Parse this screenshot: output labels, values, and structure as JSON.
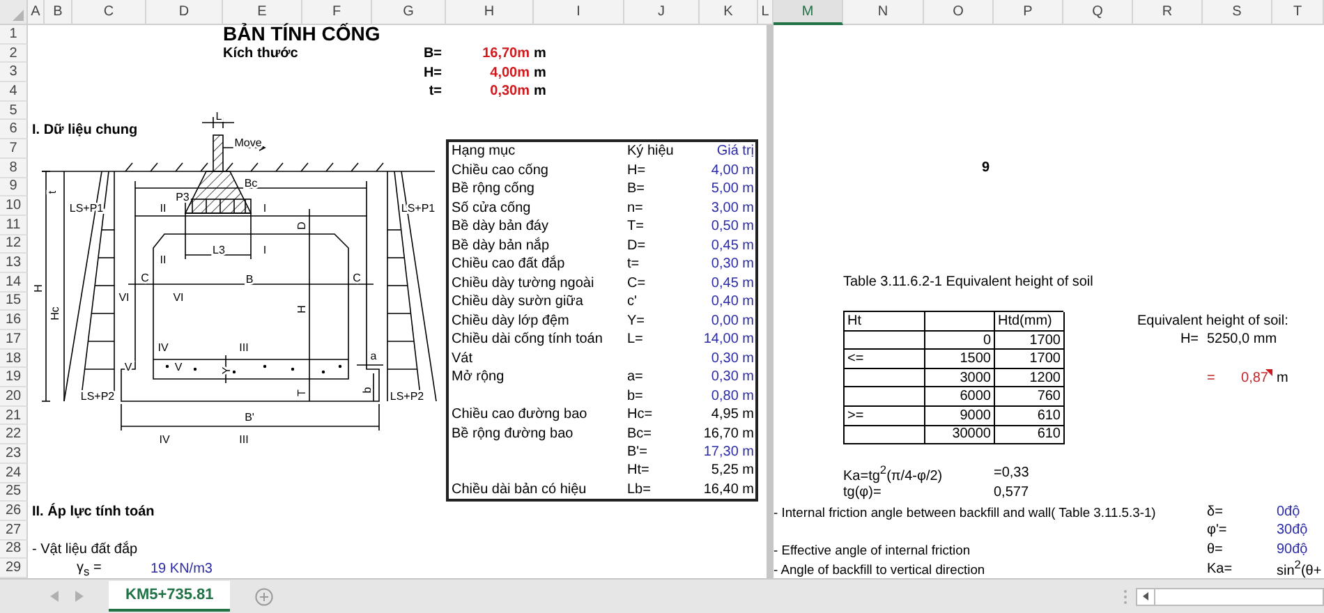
{
  "sheet": {
    "columns": [
      {
        "label": "A",
        "selected": false
      },
      {
        "label": "B",
        "selected": false
      },
      {
        "label": "C",
        "selected": false
      },
      {
        "label": "D",
        "selected": false
      },
      {
        "label": "E",
        "selected": false
      },
      {
        "label": "F",
        "selected": false
      },
      {
        "label": "G",
        "selected": false
      },
      {
        "label": "H",
        "selected": false
      },
      {
        "label": "I",
        "selected": false
      },
      {
        "label": "J",
        "selected": false
      },
      {
        "label": "K",
        "selected": false
      },
      {
        "label": "L",
        "selected": false
      },
      {
        "label": "M",
        "selected": true
      },
      {
        "label": "N",
        "selected": false
      },
      {
        "label": "O",
        "selected": false
      },
      {
        "label": "P",
        "selected": false
      },
      {
        "label": "Q",
        "selected": false
      },
      {
        "label": "R",
        "selected": false
      },
      {
        "label": "S",
        "selected": false
      },
      {
        "label": "T",
        "selected": false
      }
    ],
    "row_numbers": [
      "1",
      "2",
      "3",
      "4",
      "5",
      "6",
      "7",
      "8",
      "9",
      "10",
      "11",
      "12",
      "13",
      "14",
      "15",
      "16",
      "17",
      "18",
      "19",
      "20",
      "21",
      "22",
      "23",
      "24",
      "25",
      "26",
      "27",
      "28",
      "29"
    ]
  },
  "title": "BẢN TÍNH CỐNG",
  "dimensions": {
    "label": "Kích thước",
    "items": [
      {
        "symbol": "B=",
        "value": "16,70m",
        "unit": "m"
      },
      {
        "symbol": "H=",
        "value": "4,00m",
        "unit": "m"
      },
      {
        "symbol": "t=",
        "value": "0,30m",
        "unit": "m"
      }
    ]
  },
  "section_1": "I.  Dữ liệu chung",
  "diagram": {
    "labels": [
      "L",
      "Move",
      "Bc",
      "t",
      "P3",
      "LS+P1",
      "II",
      "I",
      "LS+P1",
      "D",
      "L3",
      "I",
      "II",
      "C",
      "B",
      "C",
      "H",
      "VI",
      "VI",
      "H",
      "Hc",
      "IV",
      "III",
      "a",
      "V",
      "V",
      "Y",
      "LS+P2",
      "T",
      "b",
      "LS+P2",
      "B'",
      "IV",
      "III"
    ]
  },
  "parameters": {
    "columns": [
      "Hạng mục",
      "Ký hiệu",
      "Giá trị"
    ],
    "rows": [
      {
        "item": "Chiều cao cống",
        "symbol": "H=",
        "value": "4,00 m",
        "color": "#2b2ba8"
      },
      {
        "item": "Bề rộng cống",
        "symbol": "B=",
        "value": "5,00 m",
        "color": "#2b2ba8"
      },
      {
        "item": "Số cửa cống",
        "symbol": "n=",
        "value": "3,00 m",
        "color": "#2b2ba8"
      },
      {
        "item": "Bề dày bản đáy",
        "symbol": "T=",
        "value": "0,50 m",
        "color": "#2b2ba8"
      },
      {
        "item": "Bề dày bản nắp",
        "symbol": "D=",
        "value": "0,45 m",
        "color": "#2b2ba8"
      },
      {
        "item": "Chiều cao đất đắp",
        "symbol": "t=",
        "value": "0,30 m",
        "color": "#2b2ba8"
      },
      {
        "item": "Chiều dày tường ngoài",
        "symbol": "C=",
        "value": "0,45 m",
        "color": "#2b2ba8"
      },
      {
        "item": "Chiều dày sườn giữa",
        "symbol": "c'",
        "value": "0,40 m",
        "color": "#2b2ba8"
      },
      {
        "item": "Chiều dày lớp đệm",
        "symbol": "Y=",
        "value": "0,00 m",
        "color": "#2b2ba8"
      },
      {
        "item": "Chiều dài cống tính toán",
        "symbol": "L=",
        "value": "14,00 m",
        "color": "#2b2ba8"
      },
      {
        "item": "Vát",
        "value": "0,30 m",
        "color": "#2b2ba8"
      },
      {
        "item": "Mở rộng",
        "symbol": "a=",
        "value": "0,30 m",
        "color": "#2b2ba8"
      },
      {
        "symbol": "b=",
        "value": "0,80 m",
        "color": "#2b2ba8"
      },
      {
        "item": "Chiều cao đường bao",
        "symbol": "Hc=",
        "value": "4,95 m",
        "color": "#000000"
      },
      {
        "item": "Bề rộng đường bao",
        "symbol": "Bc=",
        "value": "16,70 m",
        "color": "#000000"
      },
      {
        "symbol": "B'=",
        "value": "17,30 m",
        "color": "#2b2ba8"
      },
      {
        "symbol": "Ht=",
        "value": "5,25 m",
        "color": "#000000"
      },
      {
        "item": "Chiều dài bản có hiệu",
        "symbol": "Lb=",
        "value": "16,40 m",
        "color": "#000000"
      }
    ]
  },
  "page_number": "9",
  "soil_table": {
    "caption": "Table 3.11.6.2-1 Equivalent height of soil",
    "header": {
      "column_1": "Ht",
      "column_3": "Htd(mm)"
    },
    "rows": [
      {
        "ht": "0",
        "htd": "1700"
      },
      {
        "condition": "<=",
        "ht": "1500",
        "htd": "1700"
      },
      {
        "ht": "3000",
        "htd": "1200"
      },
      {
        "ht": "6000",
        "htd": "760"
      },
      {
        "condition": ">=",
        "ht": "9000",
        "htd": "610"
      },
      {
        "ht": "30000",
        "htd": "610"
      }
    ]
  },
  "equivalent_height": {
    "label": "Equivalent height of soil:",
    "symbol": "H=",
    "value": "5250,0 mm",
    "equals": "=",
    "value_m": "0,87",
    "unit": "m"
  },
  "formulas": [
    {
      "label": "Ka=tg$^{2}$(π/4-φ/2)",
      "value": "=0,33"
    },
    {
      "label": "tg(φ)=",
      "value": "0,577"
    }
  ],
  "angles": [
    {
      "description": "- Internal friction angle between backfill and wall( Table 3.11.5.3-1)",
      "symbol": "δ=",
      "value": "0độ",
      "color": "#2b2ba8"
    },
    {
      "symbol": "φ'=",
      "value": "30độ",
      "color": "#2b2ba8"
    },
    {
      "description": "- Effective angle of internal friction",
      "symbol": "θ=",
      "value": "90độ",
      "color": "#2b2ba8"
    },
    {
      "description": "- Angle of backfill to vertical direction",
      "symbol": "Ka=",
      "value": "sin$^{2}$(θ+",
      "color": "#000000"
    }
  ],
  "section_2": "II. Áp lực tính toán",
  "fill_material": {
    "label": "- Vật liệu đất đắp",
    "symbol": "γ$_{s}$ =",
    "value": "19 KN/m3"
  },
  "sheet_tabs": [
    {
      "label": "KM5+735.81",
      "selected": true
    }
  ]
}
